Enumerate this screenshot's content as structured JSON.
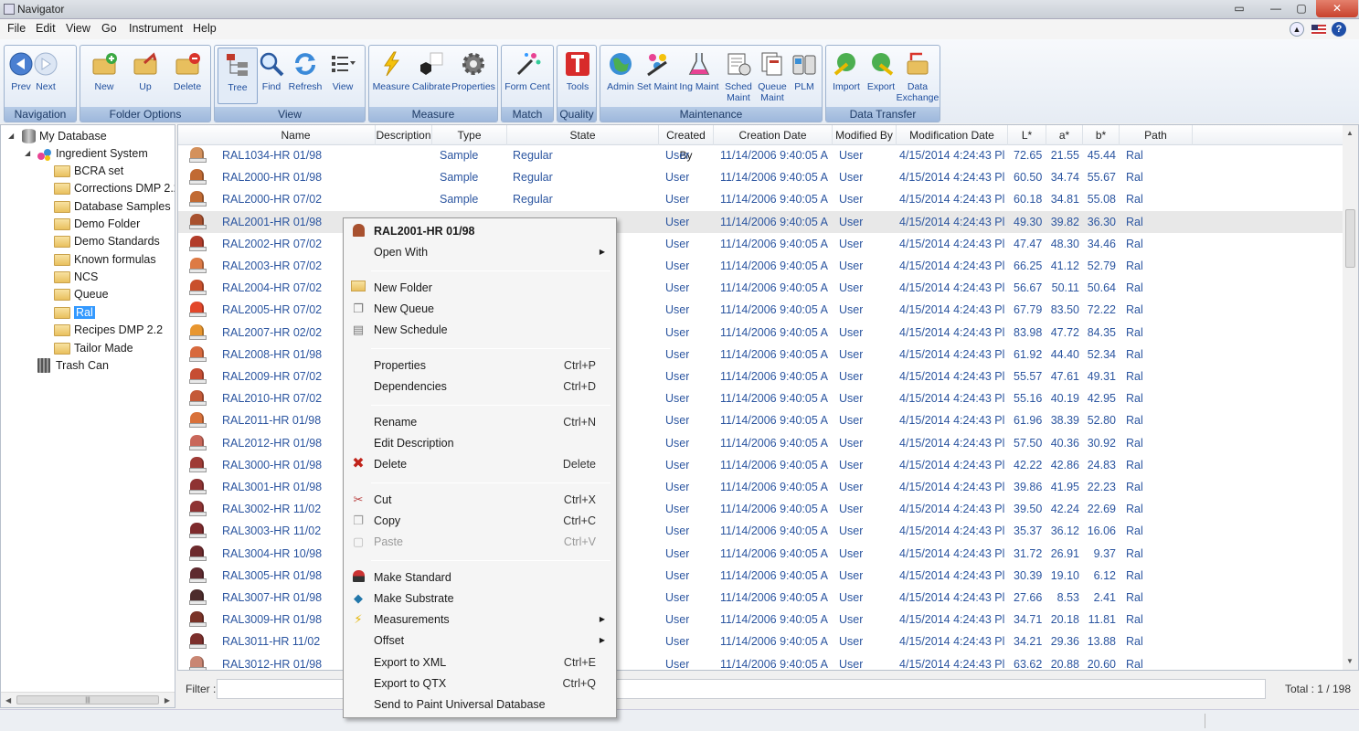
{
  "window": {
    "title": "Navigator"
  },
  "menubar": [
    "File",
    "Edit",
    "View",
    "Go",
    "Instrument",
    "Help"
  ],
  "ribbon": {
    "groups": [
      {
        "title": "Navigation",
        "buttons": [
          "Prev",
          "Next"
        ]
      },
      {
        "title": "Folder Options",
        "buttons": [
          "New",
          "Up",
          "Delete"
        ]
      },
      {
        "title": "View",
        "buttons": [
          "Tree",
          "Find",
          "Refresh",
          "View"
        ]
      },
      {
        "title": "Measure",
        "buttons": [
          "Measure",
          "Calibrate",
          "Properties"
        ]
      },
      {
        "title": "Match",
        "buttons": [
          "Form Cent"
        ]
      },
      {
        "title": "Quality",
        "buttons": [
          "Tools"
        ]
      },
      {
        "title": "Maintenance",
        "buttons": [
          "Admin",
          "Set Maint",
          "Ing Maint",
          "Sched Maint",
          "Queue Maint",
          "PLM"
        ]
      },
      {
        "title": "Data Transfer",
        "buttons": [
          "Import",
          "Export",
          "Data Exchange"
        ]
      }
    ]
  },
  "tree": {
    "root": "My Database",
    "system": "Ingredient System",
    "folders": [
      "BCRA set",
      "Corrections DMP 2.2",
      "Database Samples",
      "Demo Folder",
      "Demo Standards",
      "Known formulas",
      "NCS",
      "Queue",
      "Ral",
      "Recipes DMP 2.2",
      "Tailor Made"
    ],
    "selected": "Ral",
    "trash": "Trash Can"
  },
  "grid": {
    "columns": [
      "Name",
      "Description",
      "Type",
      "State",
      "Created By",
      "Creation Date",
      "Modified By",
      "Modification Date",
      "L*",
      "a*",
      "b*",
      "Path"
    ],
    "rows": [
      {
        "color": "#d4915c",
        "name": "RAL1034-HR 01/98",
        "type": "Sample",
        "state": "Regular",
        "created_by": "User",
        "created": "11/14/2006 9:40:05 A",
        "modified_by": "User",
        "modified": "4/15/2014 4:24:43 Pl",
        "L": "72.65",
        "a": "21.55",
        "b": "45.44",
        "path": "Ral"
      },
      {
        "color": "#c16a33",
        "name": "RAL2000-HR 01/98",
        "type": "Sample",
        "state": "Regular",
        "created_by": "User",
        "created": "11/14/2006 9:40:05 A",
        "modified_by": "User",
        "modified": "4/15/2014 4:24:43 Pl",
        "L": "60.50",
        "a": "34.74",
        "b": "55.67",
        "path": "Ral"
      },
      {
        "color": "#c16a33",
        "name": "RAL2000-HR 07/02",
        "type": "Sample",
        "state": "Regular",
        "created_by": "User",
        "created": "11/14/2006 9:40:05 A",
        "modified_by": "User",
        "modified": "4/15/2014 4:24:43 Pl",
        "L": "60.18",
        "a": "34.81",
        "b": "55.08",
        "path": "Ral"
      },
      {
        "color": "#a8512f",
        "name": "RAL2001-HR 01/98",
        "type": "",
        "state": "",
        "created_by": "User",
        "created": "11/14/2006 9:40:05 A",
        "modified_by": "User",
        "modified": "4/15/2014 4:24:43 Pl",
        "L": "49.30",
        "a": "39.82",
        "b": "36.30",
        "path": "Ral"
      },
      {
        "color": "#b23c2a",
        "name": "RAL2002-HR 07/02",
        "type": "",
        "state": "",
        "created_by": "User",
        "created": "11/14/2006 9:40:05 A",
        "modified_by": "User",
        "modified": "4/15/2014 4:24:43 Pl",
        "L": "47.47",
        "a": "48.30",
        "b": "34.46",
        "path": "Ral"
      },
      {
        "color": "#dd7a45",
        "name": "RAL2003-HR 07/02",
        "type": "",
        "state": "",
        "created_by": "User",
        "created": "11/14/2006 9:40:05 A",
        "modified_by": "User",
        "modified": "4/15/2014 4:24:43 Pl",
        "L": "66.25",
        "a": "41.12",
        "b": "52.79",
        "path": "Ral"
      },
      {
        "color": "#c9502c",
        "name": "RAL2004-HR 07/02",
        "type": "",
        "state": "",
        "created_by": "User",
        "created": "11/14/2006 9:40:05 A",
        "modified_by": "User",
        "modified": "4/15/2014 4:24:43 Pl",
        "L": "56.67",
        "a": "50.11",
        "b": "50.64",
        "path": "Ral"
      },
      {
        "color": "#e2472a",
        "name": "RAL2005-HR 07/02",
        "type": "",
        "state": "",
        "created_by": "User",
        "created": "11/14/2006 9:40:05 A",
        "modified_by": "User",
        "modified": "4/15/2014 4:24:43 Pl",
        "L": "67.79",
        "a": "83.50",
        "b": "72.22",
        "path": "Ral"
      },
      {
        "color": "#e8962f",
        "name": "RAL2007-HR 02/02",
        "type": "",
        "state": "",
        "created_by": "User",
        "created": "11/14/2006 9:40:05 A",
        "modified_by": "User",
        "modified": "4/15/2014 4:24:43 Pl",
        "L": "83.98",
        "a": "47.72",
        "b": "84.35",
        "path": "Ral"
      },
      {
        "color": "#d86a3e",
        "name": "RAL2008-HR 01/98",
        "type": "",
        "state": "",
        "created_by": "User",
        "created": "11/14/2006 9:40:05 A",
        "modified_by": "User",
        "modified": "4/15/2014 4:24:43 Pl",
        "L": "61.92",
        "a": "44.40",
        "b": "52.34",
        "path": "Ral"
      },
      {
        "color": "#c64d33",
        "name": "RAL2009-HR 07/02",
        "type": "",
        "state": "",
        "created_by": "User",
        "created": "11/14/2006 9:40:05 A",
        "modified_by": "User",
        "modified": "4/15/2014 4:24:43 Pl",
        "L": "55.57",
        "a": "47.61",
        "b": "49.31",
        "path": "Ral"
      },
      {
        "color": "#c45a38",
        "name": "RAL2010-HR 07/02",
        "type": "",
        "state": "",
        "created_by": "User",
        "created": "11/14/2006 9:40:05 A",
        "modified_by": "User",
        "modified": "4/15/2014 4:24:43 Pl",
        "L": "55.16",
        "a": "40.19",
        "b": "42.95",
        "path": "Ral"
      },
      {
        "color": "#d9713a",
        "name": "RAL2011-HR 01/98",
        "type": "",
        "state": "",
        "created_by": "User",
        "created": "11/14/2006 9:40:05 A",
        "modified_by": "User",
        "modified": "4/15/2014 4:24:43 Pl",
        "L": "61.96",
        "a": "38.39",
        "b": "52.80",
        "path": "Ral"
      },
      {
        "color": "#c9675a",
        "name": "RAL2012-HR 01/98",
        "type": "",
        "state": "",
        "created_by": "User",
        "created": "11/14/2006 9:40:05 A",
        "modified_by": "User",
        "modified": "4/15/2014 4:24:43 Pl",
        "L": "57.50",
        "a": "40.36",
        "b": "30.92",
        "path": "Ral"
      },
      {
        "color": "#9f3b36",
        "name": "RAL3000-HR 01/98",
        "type": "",
        "state": "",
        "created_by": "User",
        "created": "11/14/2006 9:40:05 A",
        "modified_by": "User",
        "modified": "4/15/2014 4:24:43 Pl",
        "L": "42.22",
        "a": "42.86",
        "b": "24.83",
        "path": "Ral"
      },
      {
        "color": "#8f3333",
        "name": "RAL3001-HR 01/98",
        "type": "",
        "state": "",
        "created_by": "User",
        "created": "11/14/2006 9:40:05 A",
        "modified_by": "User",
        "modified": "4/15/2014 4:24:43 Pl",
        "L": "39.86",
        "a": "41.95",
        "b": "22.23",
        "path": "Ral"
      },
      {
        "color": "#8e3333",
        "name": "RAL3002-HR 11/02",
        "type": "",
        "state": "",
        "created_by": "User",
        "created": "11/14/2006 9:40:05 A",
        "modified_by": "User",
        "modified": "4/15/2014 4:24:43 Pl",
        "L": "39.50",
        "a": "42.24",
        "b": "22.69",
        "path": "Ral"
      },
      {
        "color": "#7e2a2c",
        "name": "RAL3003-HR 11/02",
        "type": "",
        "state": "",
        "created_by": "User",
        "created": "11/14/2006 9:40:05 A",
        "modified_by": "User",
        "modified": "4/15/2014 4:24:43 Pl",
        "L": "35.37",
        "a": "36.12",
        "b": "16.06",
        "path": "Ral"
      },
      {
        "color": "#6d2a2d",
        "name": "RAL3004-HR 10/98",
        "type": "",
        "state": "",
        "created_by": "User",
        "created": "11/14/2006 9:40:05 A",
        "modified_by": "User",
        "modified": "4/15/2014 4:24:43 Pl",
        "L": "31.72",
        "a": "26.91",
        "b": "9.37",
        "path": "Ral"
      },
      {
        "color": "#5e2a2f",
        "name": "RAL3005-HR 01/98",
        "type": "",
        "state": "",
        "created_by": "User",
        "created": "11/14/2006 9:40:05 A",
        "modified_by": "User",
        "modified": "4/15/2014 4:24:43 Pl",
        "L": "30.39",
        "a": "19.10",
        "b": "6.12",
        "path": "Ral"
      },
      {
        "color": "#4d2c2c",
        "name": "RAL3007-HR 01/98",
        "type": "",
        "state": "",
        "created_by": "User",
        "created": "11/14/2006 9:40:05 A",
        "modified_by": "User",
        "modified": "4/15/2014 4:24:43 Pl",
        "L": "27.66",
        "a": "8.53",
        "b": "2.41",
        "path": "Ral"
      },
      {
        "color": "#7a3328",
        "name": "RAL3009-HR 01/98",
        "type": "",
        "state": "",
        "created_by": "User",
        "created": "11/14/2006 9:40:05 A",
        "modified_by": "User",
        "modified": "4/15/2014 4:24:43 Pl",
        "L": "34.71",
        "a": "20.18",
        "b": "11.81",
        "path": "Ral"
      },
      {
        "color": "#7c2f2c",
        "name": "RAL3011-HR 11/02",
        "type": "",
        "state": "",
        "created_by": "User",
        "created": "11/14/2006 9:40:05 A",
        "modified_by": "User",
        "modified": "4/15/2014 4:24:43 Pl",
        "L": "34.21",
        "a": "29.36",
        "b": "13.88",
        "path": "Ral"
      },
      {
        "color": "#c98673",
        "name": "RAL3012-HR 01/98",
        "type": "",
        "state": "",
        "created_by": "User",
        "created": "11/14/2006 9:40:05 A",
        "modified_by": "User",
        "modified": "4/15/2014 4:24:43 Pl",
        "L": "63.62",
        "a": "20.88",
        "b": "20.60",
        "path": "Ral"
      }
    ]
  },
  "context_menu": {
    "header": "RAL2001-HR 01/98",
    "open_with": "Open With",
    "new_folder": "New Folder",
    "new_queue": "New Queue",
    "new_schedule": "New Schedule",
    "properties": "Properties",
    "properties_sc": "Ctrl+P",
    "dependencies": "Dependencies",
    "dependencies_sc": "Ctrl+D",
    "rename": "Rename",
    "rename_sc": "Ctrl+N",
    "edit_description": "Edit Description",
    "delete": "Delete",
    "delete_sc": "Delete",
    "cut": "Cut",
    "cut_sc": "Ctrl+X",
    "copy": "Copy",
    "copy_sc": "Ctrl+C",
    "paste": "Paste",
    "paste_sc": "Ctrl+V",
    "make_standard": "Make Standard",
    "make_substrate": "Make Substrate",
    "measurements": "Measurements",
    "offset": "Offset",
    "export_xml": "Export to XML",
    "export_xml_sc": "Ctrl+E",
    "export_qtx": "Export to QTX",
    "export_qtx_sc": "Ctrl+Q",
    "send_paint": "Send to Paint Universal Database"
  },
  "filter": {
    "label": "Filter :",
    "value": ""
  },
  "total": "Total :  1 / 198"
}
